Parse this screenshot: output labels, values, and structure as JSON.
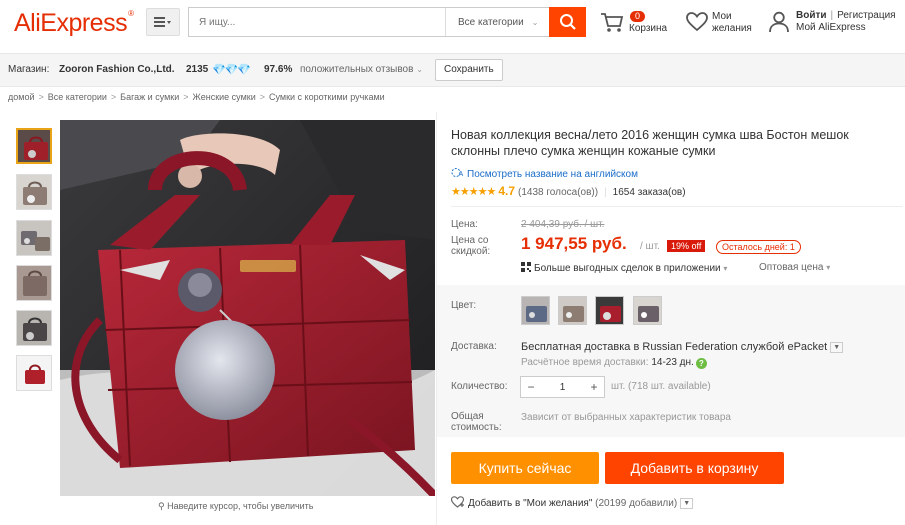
{
  "header": {
    "logo": "AliExpress",
    "logo_tm": "®",
    "search_placeholder": "Я ищу...",
    "search_category": "Все категории",
    "cart_count": "0",
    "cart_label": "Корзина",
    "wishlist_line1": "Мои",
    "wishlist_line2": "желания",
    "login": "Войти",
    "register": "Регистрация",
    "my_account": "Мой AliExpress",
    "accent_color": "#ff4400"
  },
  "store": {
    "label": "Магазин:",
    "name": "Zooron Fashion Co.,Ltd.",
    "score": "2135",
    "diamonds": "💎💎💎",
    "positive_pct": "97.6%",
    "positive_label": "положительных отзывов",
    "save_label": "Сохранить"
  },
  "breadcrumb": [
    "домой",
    "Все категории",
    "Багаж и сумки",
    "Женские сумки",
    "Сумки с короткими ручками"
  ],
  "gallery": {
    "zoom_hint": "Наведите курсор, чтобы увеличить"
  },
  "product": {
    "title": "Новая коллекция весна/лето 2016 женщин сумка шва Бостон мешок склонны плечо сумка женщин кожаные сумки",
    "translate_link": "Посмотреть название на английском",
    "stars": "★★★★★",
    "rating": "4.7",
    "votes": "(1438 голоса(ов))",
    "orders": "1654 заказа(ов)",
    "price_label": "Цена:",
    "old_price": "2 404,39 руб. / шт.",
    "discount_price_label_1": "Цена со",
    "discount_price_label_2": "скидкой:",
    "new_price": "1 947,55 руб.",
    "per_unit": "/ шт.",
    "discount": "19% off",
    "days_left": "Осталось дней: 1",
    "app_deal": "Больше выгодных сделок в приложении",
    "wholesale": "Оптовая цена",
    "color_label": "Цвет:",
    "shipping_label": "Доставка:",
    "shipping_text": "Бесплатная доставка в Russian Federation службой ePacket",
    "ship_time_label": "Расчётное время доставки:",
    "ship_time_value": "14-23 дн.",
    "quantity_label": "Количество:",
    "quantity_value": "1",
    "quantity_available": "шт. (718 шт. available)",
    "total_label_1": "Общая",
    "total_label_2": "стоимость:",
    "total_note": "Зависит от выбранных характеристик товара",
    "buy_now": "Купить сейчас",
    "add_to_cart": "Добавить в корзину",
    "add_wishlist": "Добавить в \"Мои желания\"",
    "wishlist_count": "(20199 добавили)"
  }
}
